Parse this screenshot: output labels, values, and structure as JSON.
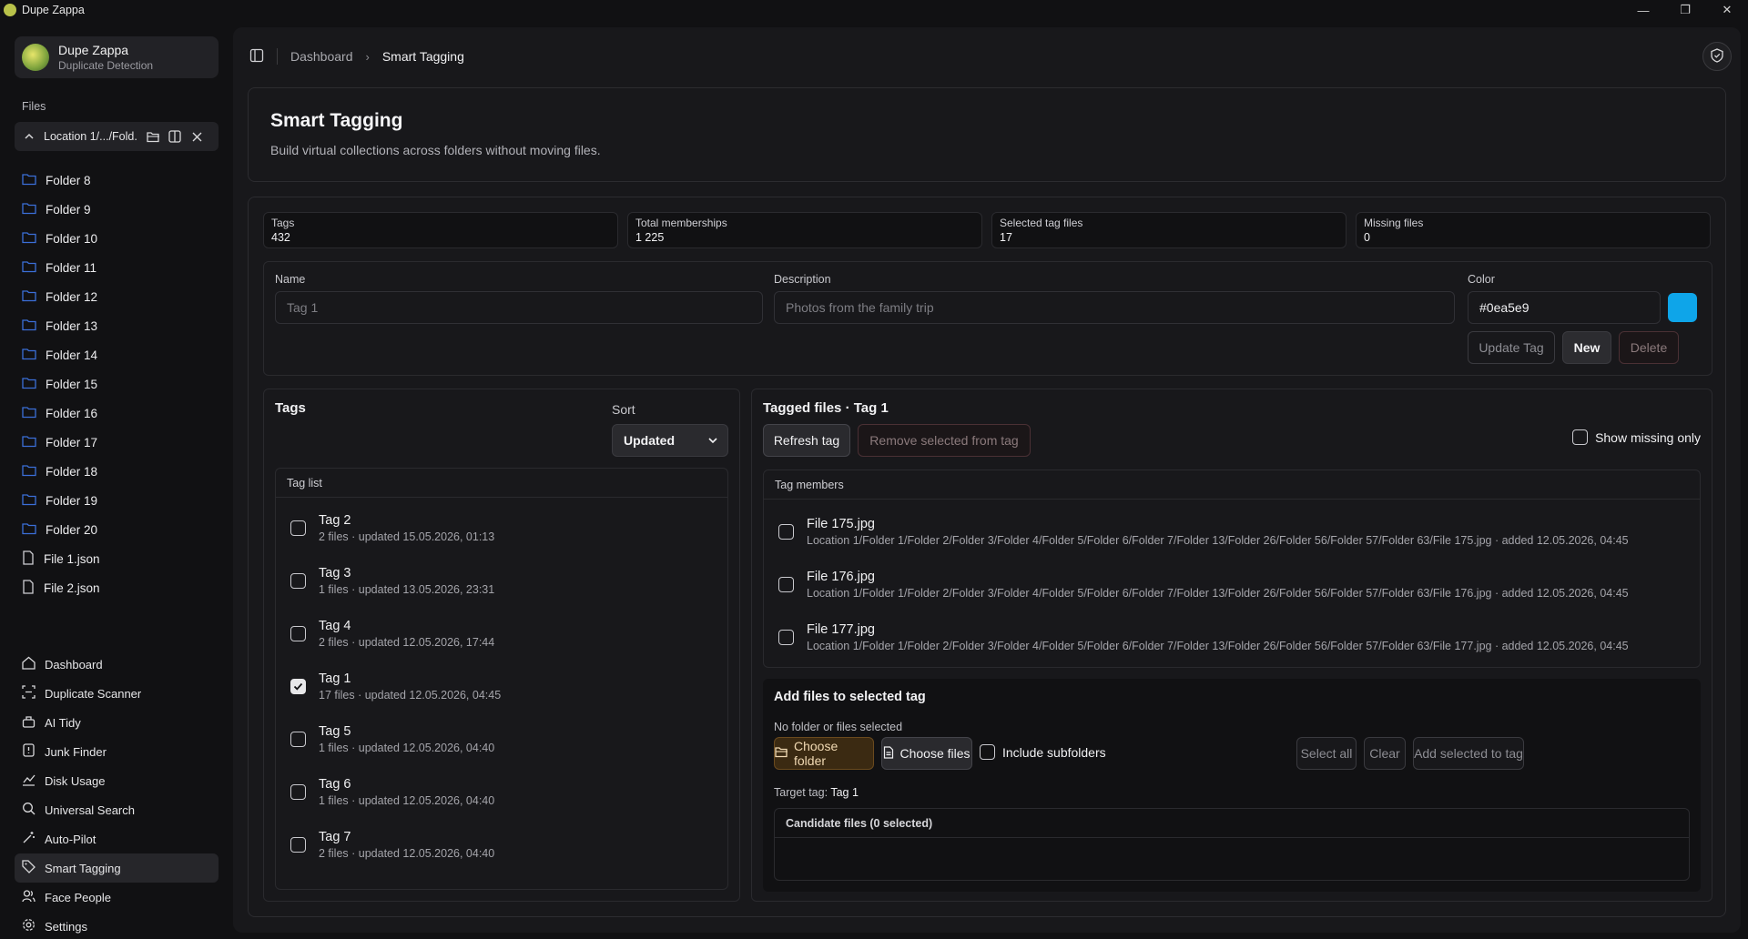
{
  "window": {
    "title": "Dupe Zappa"
  },
  "brand": {
    "name": "Dupe Zappa",
    "subtitle": "Duplicate Detection"
  },
  "files_section": {
    "label": "Files",
    "location": "Location 1/.../Fold..."
  },
  "tree": [
    {
      "label": "Folder 8",
      "icon": "folder-icon"
    },
    {
      "label": "Folder 9",
      "icon": "folder-icon"
    },
    {
      "label": "Folder 10",
      "icon": "folder-icon"
    },
    {
      "label": "Folder 11",
      "icon": "folder-icon"
    },
    {
      "label": "Folder 12",
      "icon": "folder-icon"
    },
    {
      "label": "Folder 13",
      "icon": "folder-icon"
    },
    {
      "label": "Folder 14",
      "icon": "folder-icon"
    },
    {
      "label": "Folder 15",
      "icon": "folder-icon"
    },
    {
      "label": "Folder 16",
      "icon": "folder-icon"
    },
    {
      "label": "Folder 17",
      "icon": "folder-icon"
    },
    {
      "label": "Folder 18",
      "icon": "folder-icon"
    },
    {
      "label": "Folder 19",
      "icon": "folder-icon"
    },
    {
      "label": "Folder 20",
      "icon": "folder-icon"
    },
    {
      "label": "File 1.json",
      "icon": "file-icon"
    },
    {
      "label": "File 2.json",
      "icon": "file-icon"
    }
  ],
  "nav": [
    {
      "label": "Dashboard",
      "icon": "dashboard-icon"
    },
    {
      "label": "Duplicate Scanner",
      "icon": "scan-icon"
    },
    {
      "label": "AI Tidy",
      "icon": "broom-icon"
    },
    {
      "label": "Junk Finder",
      "icon": "junk-icon"
    },
    {
      "label": "Disk Usage",
      "icon": "chart-icon"
    },
    {
      "label": "Universal Search",
      "icon": "search-icon"
    },
    {
      "label": "Auto-Pilot",
      "icon": "wand-icon"
    },
    {
      "label": "Smart Tagging",
      "icon": "tag-icon",
      "active": true
    },
    {
      "label": "Face People",
      "icon": "people-icon"
    },
    {
      "label": "Settings",
      "icon": "gear-icon"
    }
  ],
  "breadcrumb": {
    "parent": "Dashboard",
    "current": "Smart Tagging"
  },
  "page": {
    "title": "Smart Tagging",
    "description": "Build virtual collections across folders without moving files."
  },
  "stats": [
    {
      "label": "Tags",
      "value": "432"
    },
    {
      "label": "Total memberships",
      "value": "1 225"
    },
    {
      "label": "Selected tag files",
      "value": "17"
    },
    {
      "label": "Missing files",
      "value": "0"
    }
  ],
  "form": {
    "name_label": "Name",
    "name_placeholder": "Tag 1",
    "description_label": "Description",
    "description_placeholder": "Photos from the family trip",
    "color_label": "Color",
    "color_value": "#0ea5e9",
    "update_button": "Update Tag",
    "new_button": "New",
    "delete_button": "Delete"
  },
  "tags_panel": {
    "title": "Tags",
    "sort_label": "Sort",
    "sort_value": "Updated",
    "list_header": "Tag list",
    "items": [
      {
        "name": "Tag 2",
        "meta": "2 files · updated 15.05.2026, 01:13",
        "checked": false
      },
      {
        "name": "Tag 3",
        "meta": "1 files · updated 13.05.2026, 23:31",
        "checked": false
      },
      {
        "name": "Tag 4",
        "meta": "2 files · updated 12.05.2026, 17:44",
        "checked": false
      },
      {
        "name": "Tag 1",
        "meta": "17 files · updated 12.05.2026, 04:45",
        "checked": true
      },
      {
        "name": "Tag 5",
        "meta": "1 files · updated 12.05.2026, 04:40",
        "checked": false
      },
      {
        "name": "Tag 6",
        "meta": "1 files · updated 12.05.2026, 04:40",
        "checked": false
      },
      {
        "name": "Tag 7",
        "meta": "2 files · updated 12.05.2026, 04:40",
        "checked": false
      }
    ]
  },
  "files_panel": {
    "title": "Tagged files · Tag 1",
    "refresh_button": "Refresh tag",
    "remove_button": "Remove selected from tag",
    "show_missing_label": "Show missing only",
    "members_header": "Tag members",
    "members": [
      {
        "name": "File 175.jpg",
        "path": "Location 1/Folder 1/Folder 2/Folder 3/Folder 4/Folder 5/Folder 6/Folder 7/Folder 13/Folder 26/Folder 56/Folder 57/Folder 63/File 175.jpg · added 12.05.2026, 04:45"
      },
      {
        "name": "File 176.jpg",
        "path": "Location 1/Folder 1/Folder 2/Folder 3/Folder 4/Folder 5/Folder 6/Folder 7/Folder 13/Folder 26/Folder 56/Folder 57/Folder 63/File 176.jpg · added 12.05.2026, 04:45"
      },
      {
        "name": "File 177.jpg",
        "path": "Location 1/Folder 1/Folder 2/Folder 3/Folder 4/Folder 5/Folder 6/Folder 7/Folder 13/Folder 26/Folder 56/Folder 57/Folder 63/File 177.jpg · added 12.05.2026, 04:45"
      }
    ],
    "add": {
      "title": "Add files to selected tag",
      "status": "No folder or files selected",
      "choose_folder": "Choose folder",
      "choose_files": "Choose files",
      "include_subfolders": "Include subfolders",
      "select_all": "Select all",
      "clear": "Clear",
      "add_selected": "Add selected to tag",
      "target_label": "Target tag:",
      "target_value": "Tag 1",
      "candidates_header": "Candidate files (0 selected)"
    }
  }
}
